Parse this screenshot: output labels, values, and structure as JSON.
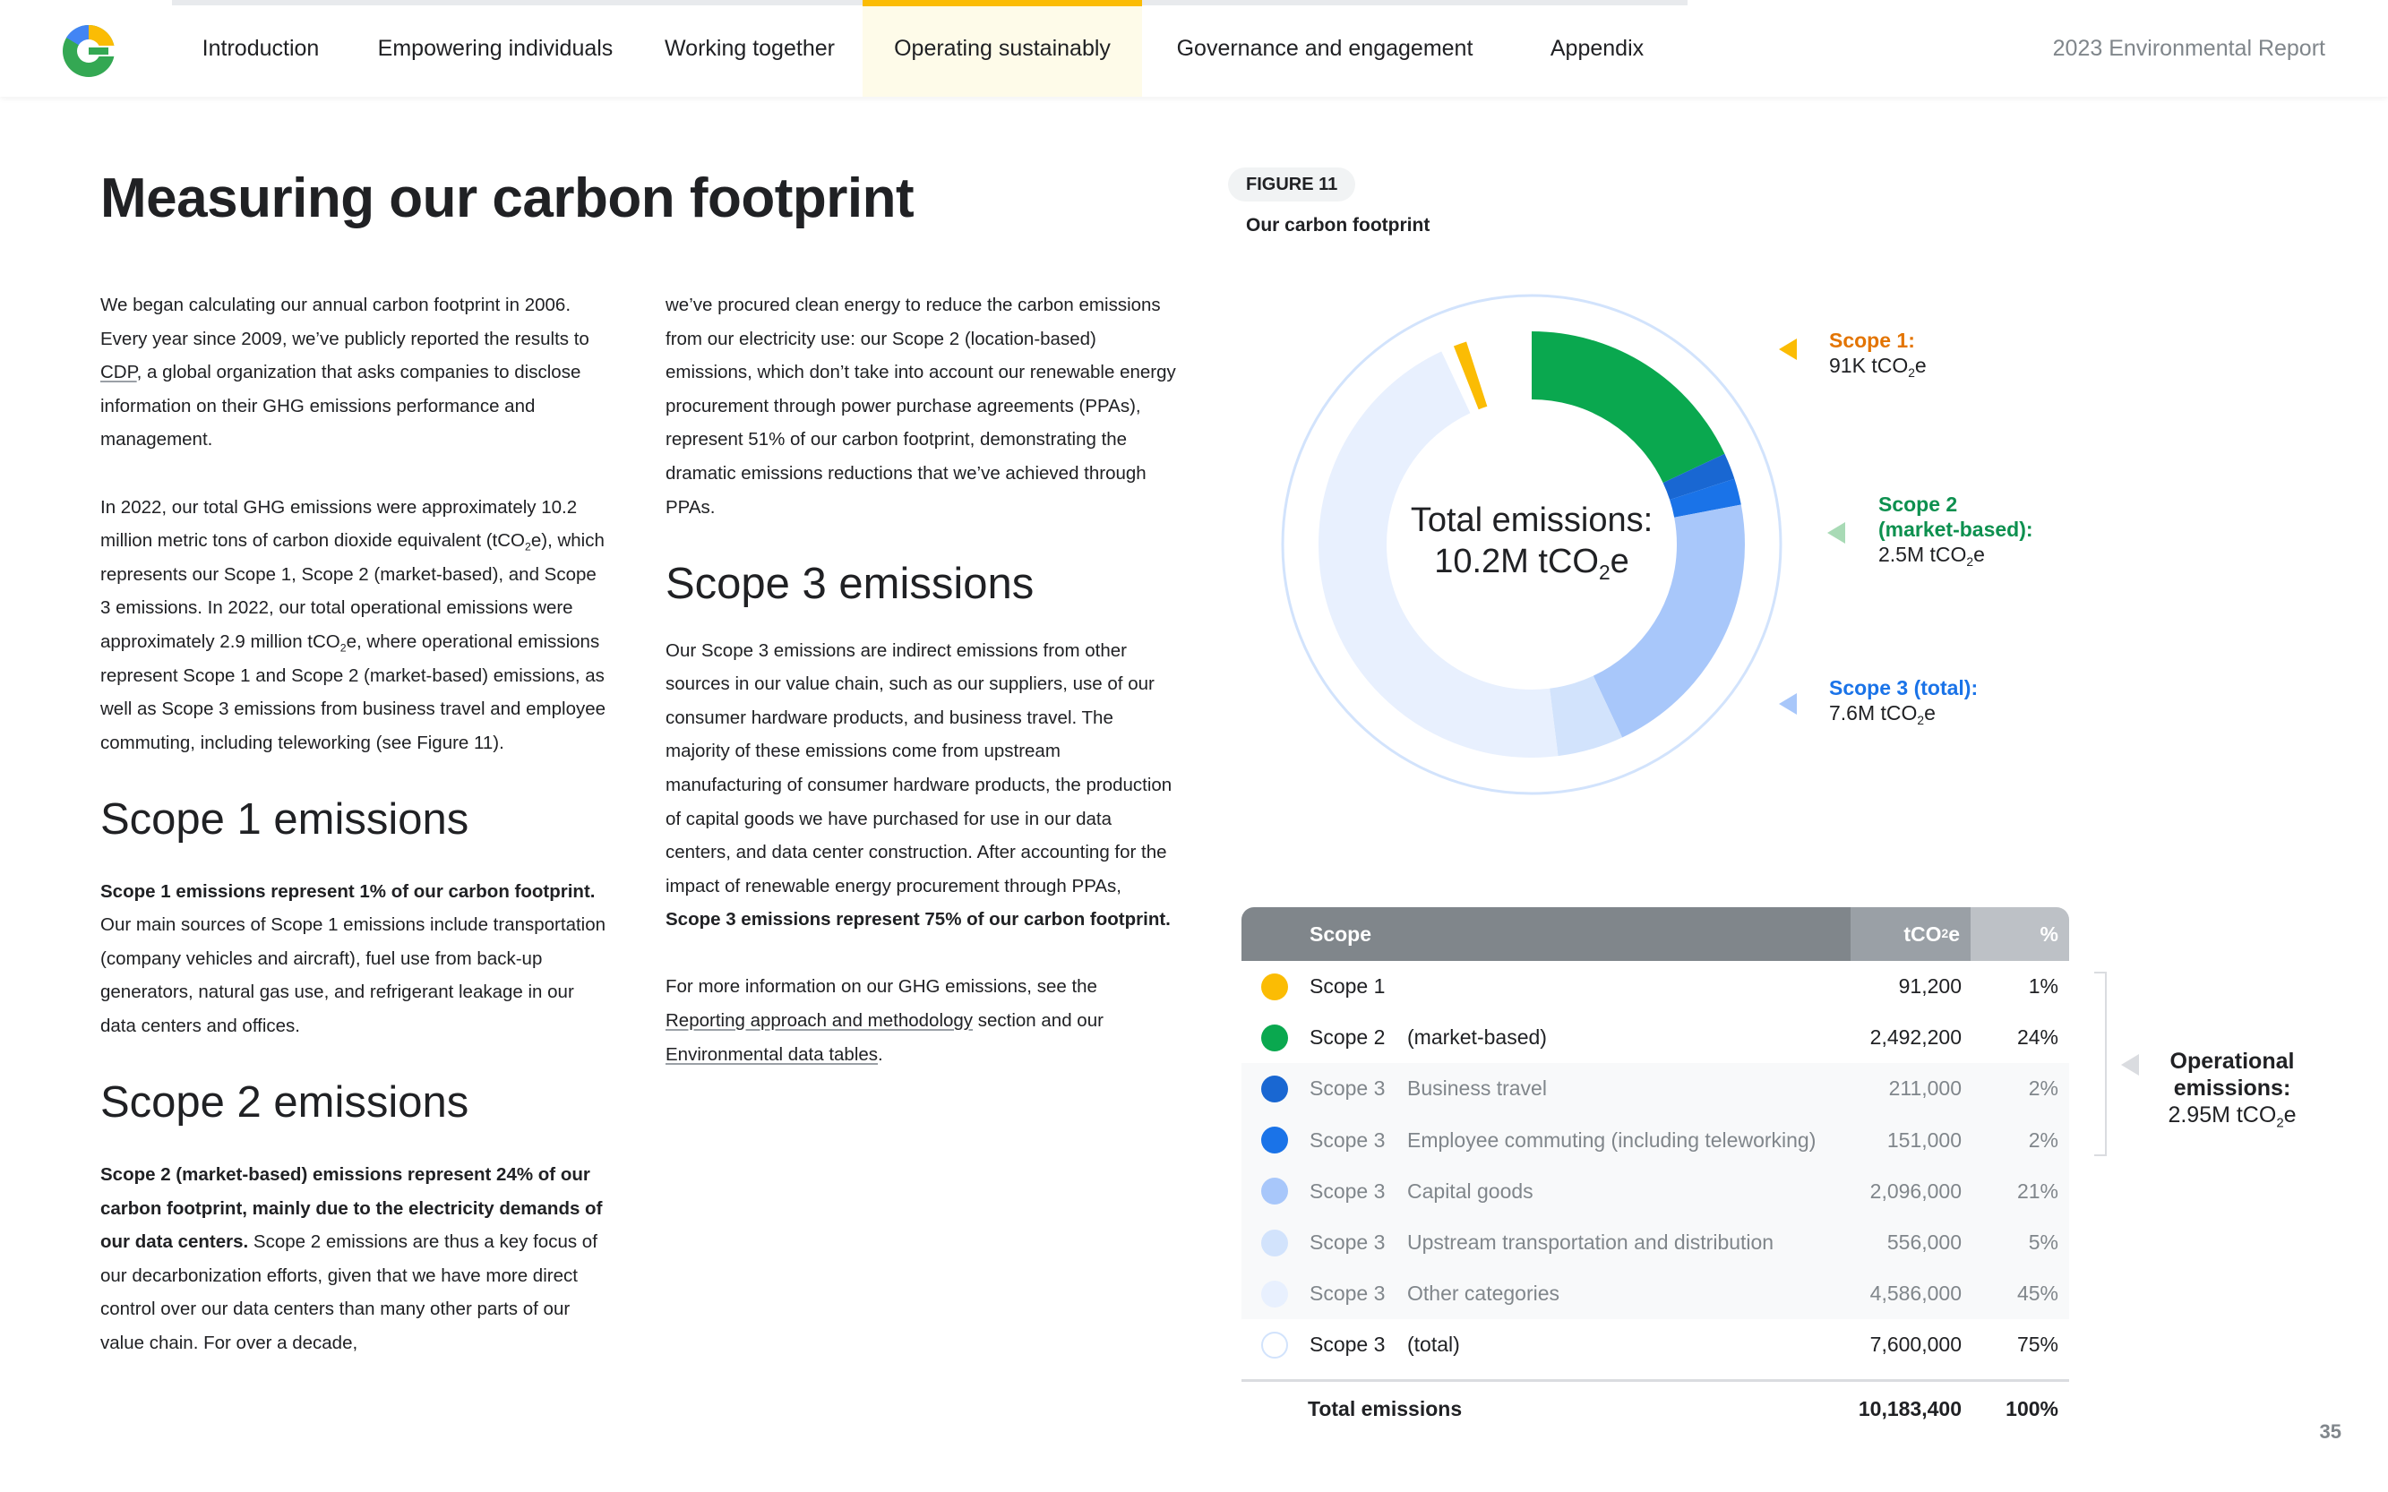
{
  "nav": {
    "tabs": [
      {
        "label": "Introduction"
      },
      {
        "label": "Empowering individuals"
      },
      {
        "label": "Working together"
      },
      {
        "label": "Operating sustainably"
      },
      {
        "label": "Governance and engagement"
      },
      {
        "label": "Appendix"
      }
    ],
    "active_index": 3,
    "report_name": "2023 Environmental Report"
  },
  "page": {
    "title": "Measuring our carbon footprint",
    "number": "35"
  },
  "colors": {
    "google_yellow": "#fbbc04",
    "google_green": "#0aa84f",
    "google_blue_dark": "#1967d2",
    "google_blue": "#1a73e8",
    "scope1_label": "#e37400",
    "scope2_label": "#0d904f",
    "scope3_label": "#1a73e8"
  },
  "body": {
    "intro_p1_a": "We began calculating our annual carbon footprint in 2006. Every year since 2009, we’ve publicly reported the results to ",
    "intro_p1_link": "CDP",
    "intro_p1_b": ", a global organization that asks companies to disclose information on their GHG emissions performance and management.",
    "intro_p2_a": "In 2022, our total GHG emissions were approximately 10.2 million metric tons of carbon dioxide equivalent (tCO",
    "intro_p2_b": "e), which represents our Scope 1, Scope 2 (market-based), and Scope 3 emissions. In 2022, our total operational emissions were approximately 2.9 million tCO",
    "intro_p2_c": "e, where operational emissions represent Scope 1 and Scope 2 (market-based) emissions, as well as Scope 3 emissions from business travel and employee commuting, including teleworking (see Figure 11).",
    "scope1_heading": "Scope 1 emissions",
    "scope1_bold": "Scope 1 emissions represent 1% of our carbon footprint.",
    "scope1_text": " Our main sources of Scope 1 emissions include transportation (company vehicles and aircraft), fuel use from back-up generators, natural gas use, and refrigerant leakage in our data centers and offices.",
    "scope2_heading": "Scope 2 emissions",
    "scope2_bold": "Scope 2 (market-based) emissions represent 24% of our carbon footprint, mainly due to the electricity demands of our data centers.",
    "scope2_text": " Scope 2 emissions are thus a key focus of our decarbonization efforts, given that we have more direct control over our data centers than many other parts of our value chain. For over a decade,",
    "col2_p1": "we’ve procured clean energy to reduce the carbon emissions from our electricity use: our Scope 2 (location-based) emissions, which don’t take into account our renewable energy procurement through power purchase agreements (PPAs), represent 51% of our carbon footprint, demonstrating the dramatic emissions reductions that we’ve achieved through PPAs.",
    "scope3_heading": "Scope 3 emissions",
    "scope3_text": "Our Scope 3 emissions are indirect emissions from other sources in our value chain, such as our suppliers, use of our consumer hardware products, and business travel. The majority of these emissions come from upstream manufacturing of consumer hardware products, the production of capital goods we have purchased for use in our data centers, and data center construction. After accounting for the impact of renewable energy procurement through PPAs, ",
    "scope3_bold": "Scope 3 emissions represent 75% of our carbon footprint.",
    "more_a": "For more information on our GHG emissions, see the ",
    "more_link1": "Reporting approach and methodology",
    "more_b": " section and our ",
    "more_link2": "Environmental data tables",
    "more_c": "."
  },
  "figure": {
    "tag": "FIGURE 11",
    "title": "Our carbon footprint",
    "center_label": "Total emissions:",
    "center_value_a": "10.2M tCO",
    "center_value_b": "e",
    "callouts": {
      "scope1_label": "Scope 1:",
      "scope1_value": "91K tCO",
      "scope2_label_a": "Scope 2",
      "scope2_label_b": "(market-based):",
      "scope2_value": "2.5M tCO",
      "scope3_label": "Scope 3 (total):",
      "scope3_value": "7.6M tCO",
      "unit_sub": "2",
      "unit_e": "e"
    },
    "segments": [
      {
        "name": "Scope 1",
        "percent": 1,
        "color": "#fbbc04"
      },
      {
        "name": "Scope 2 (market-based)",
        "percent": 24,
        "color": "#0aa84f"
      },
      {
        "name": "Scope 3 Business travel",
        "percent": 2,
        "color": "#1967d2"
      },
      {
        "name": "Scope 3 Employee commuting",
        "percent": 2,
        "color": "#1a73e8"
      },
      {
        "name": "Scope 3 Capital goods",
        "percent": 21,
        "color": "#a8c7fa"
      },
      {
        "name": "Scope 3 Upstream transportation and distribution",
        "percent": 5,
        "color": "#d2e3fc"
      },
      {
        "name": "Scope 3 Other categories",
        "percent": 45,
        "color": "#e8f0fe"
      }
    ]
  },
  "table": {
    "headers": {
      "scope": "Scope",
      "value_a": "tCO",
      "value_b": "e",
      "percent": "%"
    },
    "rows": [
      {
        "scope": "Scope 1",
        "sub": "",
        "value": "91,200",
        "percent": "1%",
        "dot": "#fbbc04"
      },
      {
        "scope": "Scope 2",
        "sub": "(market-based)",
        "value": "2,492,200",
        "percent": "24%",
        "dot": "#0aa84f"
      },
      {
        "scope": "Scope 3",
        "sub": "Business travel",
        "value": "211,000",
        "percent": "2%",
        "dot": "#1967d2"
      },
      {
        "scope": "Scope 3",
        "sub": "Employee commuting (including teleworking)",
        "value": "151,000",
        "percent": "2%",
        "dot": "#1a73e8"
      },
      {
        "scope": "Scope 3",
        "sub": "Capital goods",
        "value": "2,096,000",
        "percent": "21%",
        "dot": "#a8c7fa"
      },
      {
        "scope": "Scope 3",
        "sub": "Upstream transportation and distribution",
        "value": "556,000",
        "percent": "5%",
        "dot": "#d2e3fc"
      },
      {
        "scope": "Scope 3",
        "sub": "Other categories",
        "value": "4,586,000",
        "percent": "45%",
        "dot": "#e8f0fe"
      },
      {
        "scope": "Scope 3",
        "sub": "(total)",
        "value": "7,600,000",
        "percent": "75%",
        "dot": "#ffffff"
      }
    ],
    "total": {
      "label": "Total emissions",
      "value": "10,183,400",
      "percent": "100%"
    },
    "operational_a": "Operational",
    "operational_b": "emissions:",
    "operational_c": "2.95M tCO",
    "operational_d": "e"
  }
}
